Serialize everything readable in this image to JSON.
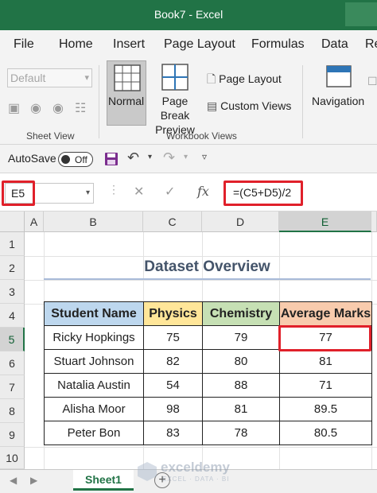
{
  "window": {
    "title": "Book7  -  Excel"
  },
  "menu_tabs": [
    "File",
    "Home",
    "Insert",
    "Page Layout",
    "Formulas",
    "Data",
    "Re"
  ],
  "ribbon": {
    "sheet_view": {
      "dropdown_value": "Default",
      "group_label": "Sheet View"
    },
    "workbook_views": {
      "normal_label": "Normal",
      "page_break_label": "Page Break Preview",
      "page_layout_label": "Page Layout",
      "custom_views_label": "Custom Views",
      "group_label": "Workbook Views"
    },
    "navigation_label": "Navigation"
  },
  "quick_access": {
    "autosave_label": "AutoSave",
    "autosave_state": "Off"
  },
  "formula_bar": {
    "name_box": "E5",
    "formula": "=(C5+D5)/2"
  },
  "grid": {
    "column_headers": [
      "A",
      "B",
      "C",
      "D",
      "E"
    ],
    "row_headers": [
      "1",
      "2",
      "3",
      "4",
      "5",
      "6",
      "7",
      "8",
      "9",
      "10"
    ],
    "selected_column": "E",
    "selected_row": "5"
  },
  "dataset": {
    "title": "Dataset Overview",
    "headers": [
      "Student Name",
      "Physics",
      "Chemistry",
      "Average Marks"
    ],
    "rows": [
      [
        "Ricky Hopkings",
        "75",
        "79",
        "77"
      ],
      [
        "Stuart Johnson",
        "82",
        "80",
        "81"
      ],
      [
        "Natalia Austin",
        "54",
        "88",
        "71"
      ],
      [
        "Alisha Moor",
        "98",
        "81",
        "89.5"
      ],
      [
        "Peter Bon",
        "83",
        "78",
        "80.5"
      ]
    ]
  },
  "sheet_tabs": [
    "Sheet1"
  ],
  "watermark": {
    "name": "exceldemy",
    "tagline": "EXCEL · DATA · BI"
  },
  "colors": {
    "excel_green": "#217346",
    "header_blue": "#bdd7ee",
    "header_yellow": "#ffe699",
    "header_green": "#c6e0b4",
    "header_orange": "#f8cbad",
    "highlight_red": "#e0202a",
    "title_color": "#44546a"
  }
}
